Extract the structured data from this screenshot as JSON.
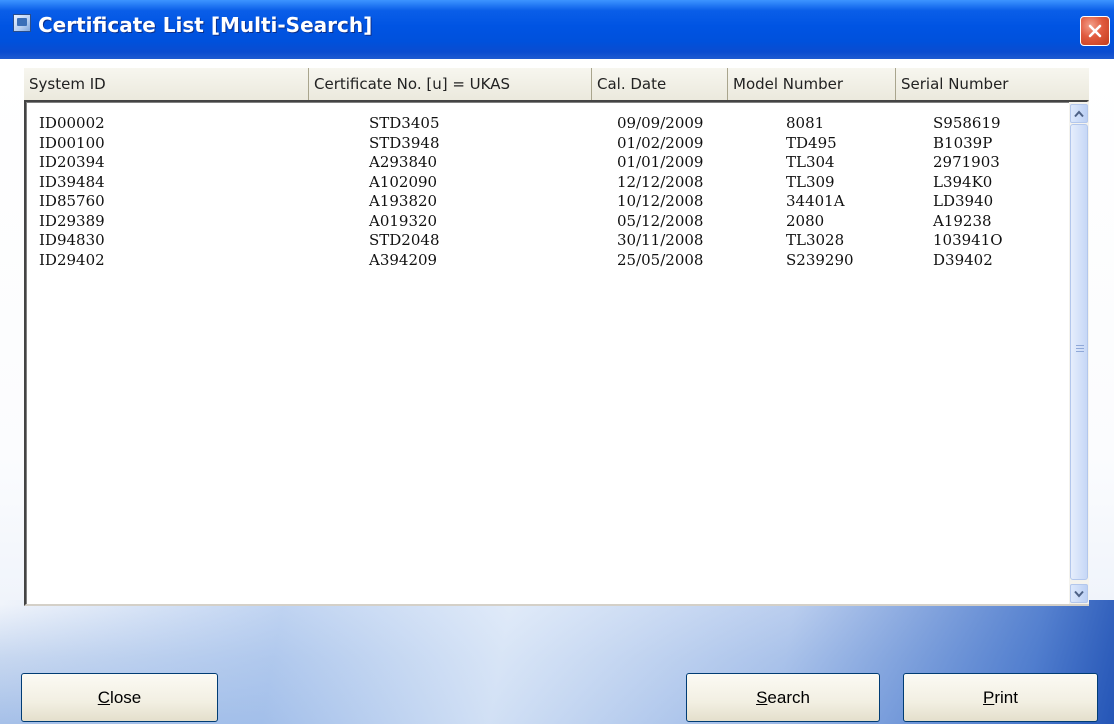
{
  "window": {
    "title": "Certificate List [Multi-Search]",
    "icon": "app-icon",
    "close_icon": "close-icon",
    "colors": {
      "titlebar": "#0054e3",
      "close": "#e05a3e",
      "face": "#ece9d8"
    }
  },
  "columns": [
    {
      "label": "System ID"
    },
    {
      "label": "Certificate No. [u] = UKAS"
    },
    {
      "label": "Cal. Date"
    },
    {
      "label": "Model Number"
    },
    {
      "label": "Serial Number"
    }
  ],
  "rows": [
    [
      "ID00002",
      "STD3405",
      "09/09/2009",
      "8081",
      "S958619"
    ],
    [
      "ID00100",
      "STD3948",
      "01/02/2009",
      "TD495",
      "B1039P"
    ],
    [
      "ID20394",
      "A293840",
      "01/01/2009",
      "TL304",
      "2971903"
    ],
    [
      "ID39484",
      "A102090",
      "12/12/2008",
      "TL309",
      "L394K0"
    ],
    [
      "ID85760",
      "A193820",
      "10/12/2008",
      "34401A",
      "LD3940"
    ],
    [
      "ID29389",
      "A019320",
      "05/12/2008",
      "2080",
      "A19238"
    ],
    [
      "ID94830",
      "STD2048",
      "30/11/2008",
      "TL3028",
      "103941O"
    ],
    [
      "ID29402",
      "A394209",
      "25/05/2008",
      "S239290",
      "D39402"
    ]
  ],
  "scrollbar": {
    "up_icon": "chevron-up-icon",
    "down_icon": "chevron-down-icon"
  },
  "buttons": {
    "close": {
      "mnemonic": "C",
      "rest": "lose"
    },
    "search": {
      "mnemonic": "S",
      "rest": "earch"
    },
    "print": {
      "mnemonic": "P",
      "rest": "rint"
    }
  }
}
